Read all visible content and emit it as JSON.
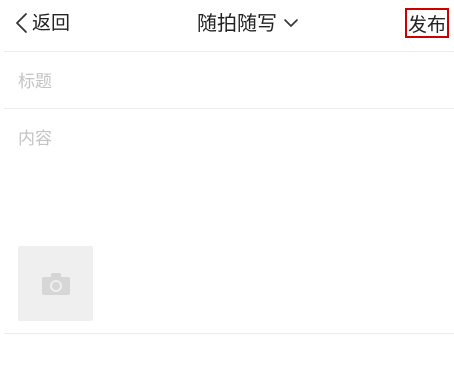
{
  "navbar": {
    "back_label": "返回",
    "title": "随拍随写",
    "publish_label": "发布"
  },
  "form": {
    "title_placeholder": "标题",
    "content_placeholder": "内容"
  },
  "icons": {
    "back": "chevron-left-icon",
    "title_dropdown": "chevron-down-icon",
    "add_photo": "camera-icon"
  },
  "colors": {
    "publish_highlight_border": "#cc0000",
    "placeholder_text": "#c4c4c4",
    "photo_tile_bg": "#efefef"
  }
}
